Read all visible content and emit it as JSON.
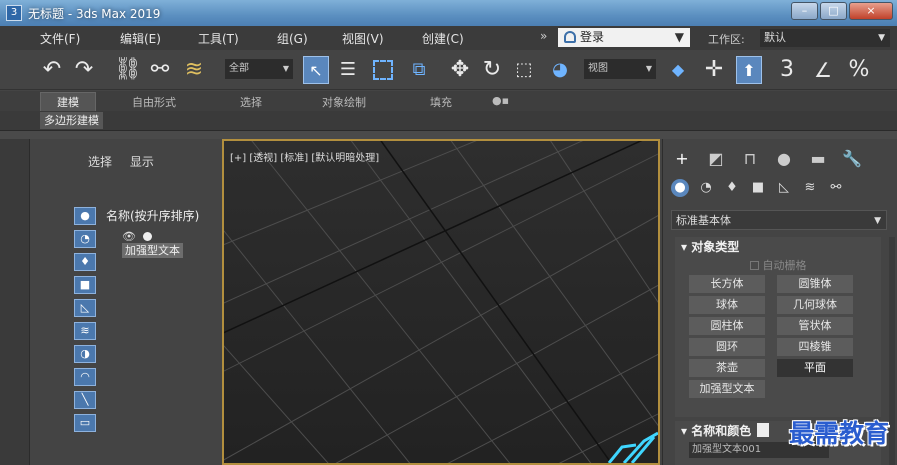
{
  "window": {
    "title": "无标题 - 3ds Max 2019",
    "buttons": [
      "–",
      "□",
      "×"
    ]
  },
  "menubar": {
    "items": [
      "文件(F)",
      "编辑(E)",
      "工具(T)",
      "组(G)",
      "视图(V)",
      "创建(C)"
    ],
    "more": "»",
    "login_label": "登录",
    "workspace_label": "工作区:",
    "workspace_value": "默认"
  },
  "toolbar": {
    "selection_filter": "全部",
    "ref_coord": "视图",
    "snap_label": "3",
    "percent_label": "%"
  },
  "ribbon": {
    "tabs": [
      "建模",
      "自由形式",
      "选择",
      "对象绘制",
      "填充"
    ],
    "sub_button": "多边形建模"
  },
  "explorer": {
    "tabs": [
      "选择",
      "显示"
    ],
    "header": "名称(按升序排序)",
    "object_name": "加强型文本"
  },
  "viewport": {
    "label": "[+] [透视] [标准] [默认明暗处理]"
  },
  "command_panel": {
    "dropdown": "标准基本体",
    "rollout_object_type": "对象类型",
    "auto_grid": "自动栅格",
    "object_buttons": [
      "长方体",
      "圆锥体",
      "球体",
      "几何球体",
      "圆柱体",
      "管状体",
      "圆环",
      "四棱锥",
      "茶壶",
      "平面",
      "加强型文本"
    ],
    "selected_button": "平面",
    "rollout_name_color": "名称和颜色",
    "object_name_value": "加强型文本001"
  },
  "watermark": "最需教育",
  "colors": {
    "accent": "#5a87bd",
    "viewport_border": "#b28f3e",
    "text_object": "#3fd6ff"
  }
}
